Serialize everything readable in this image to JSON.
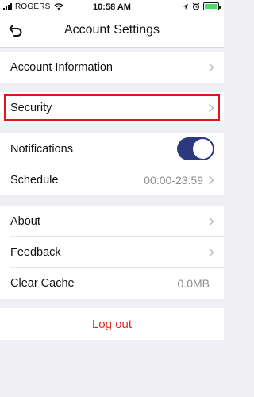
{
  "status_bar": {
    "carrier": "ROGERS",
    "time": "10:58 AM"
  },
  "header": {
    "title": "Account Settings",
    "back_icon": "back-arrow-icon"
  },
  "groups": [
    {
      "rows": [
        {
          "label": "Account Information",
          "icon": "chevron-right-icon"
        }
      ]
    },
    {
      "rows": [
        {
          "label": "Security",
          "icon": "chevron-right-icon",
          "highlighted": true
        }
      ]
    },
    {
      "rows": [
        {
          "label": "Notifications",
          "toggle_on": true
        },
        {
          "label": "Schedule",
          "value": "00:00-23:59",
          "icon": "chevron-right-icon"
        }
      ]
    },
    {
      "rows": [
        {
          "label": "About",
          "icon": "chevron-right-icon"
        },
        {
          "label": "Feedback",
          "icon": "chevron-right-icon"
        },
        {
          "label": "Clear Cache",
          "value": "0.0MB"
        }
      ]
    }
  ],
  "logout_label": "Log out",
  "colors": {
    "accent_red": "#e3231c",
    "highlight_border": "#e0151a",
    "toggle_on": "#2b3a7e",
    "battery": "#4cd964"
  }
}
